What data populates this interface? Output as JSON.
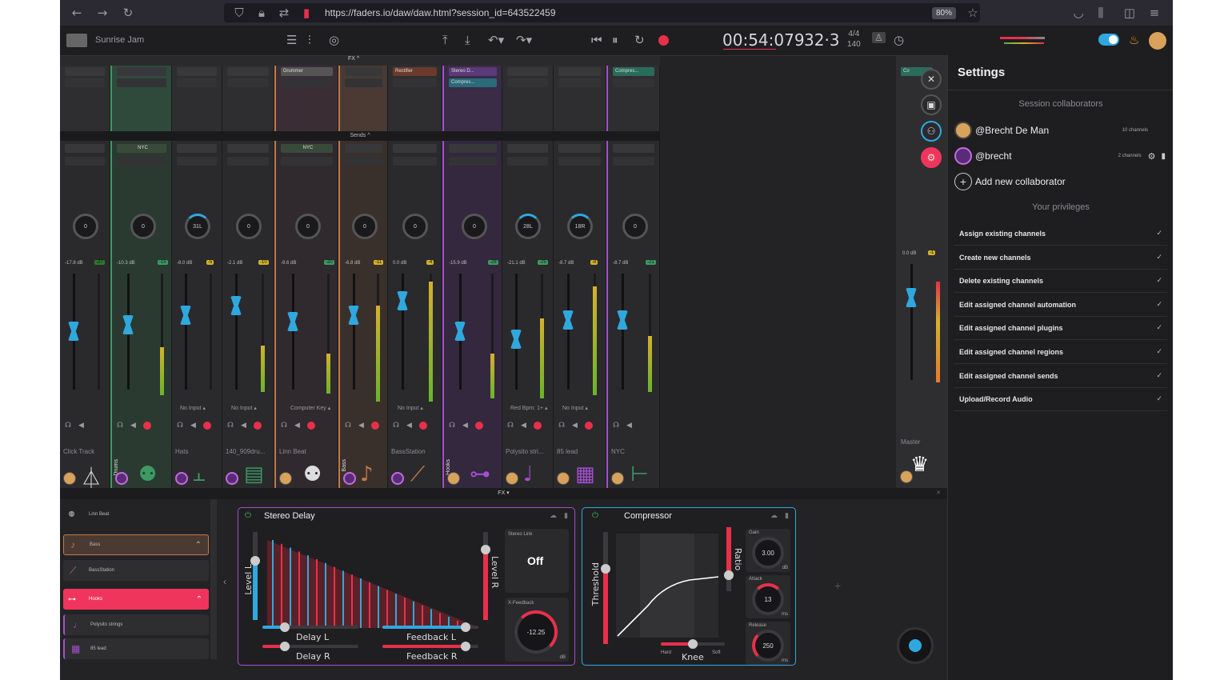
{
  "browser": {
    "url": "https://faders.io/daw/daw.html?session_id=643522459",
    "zoom": "80%"
  },
  "toolbar": {
    "session_name": "Sunrise Jam",
    "time": "00:54:079",
    "position": "32·3",
    "time_signature": "4/4",
    "tempo": "140"
  },
  "mixer": {
    "fx_label": "FX ^",
    "sends_label": "Sends ^",
    "fx_label_bottom": "FX ▾",
    "channels": [
      {
        "name": "Click Track",
        "db": "-17.8 dB",
        "peak": "-27",
        "knob": "0",
        "input": "",
        "icon": "metronome-icon"
      },
      {
        "name": "",
        "group": "Drums",
        "db": "-10.3 dB",
        "peak": "-15",
        "knob": "0",
        "input": "",
        "send": "NYC",
        "icon": "drums-icon"
      },
      {
        "name": "Hats",
        "db": "-8.0 dB",
        "peak": "-5",
        "knob": "31L",
        "input": "No Input",
        "icon": "hihat-icon"
      },
      {
        "name": "140_909dru...",
        "db": "-2.1 dB",
        "peak": "-10",
        "knob": "0",
        "input": "No Input",
        "icon": "drum-machine-icon"
      },
      {
        "name": "Linn Beat",
        "db": "-9.6 dB",
        "peak": "-20",
        "knob": "0",
        "input": "Computer Key",
        "send": "NYC",
        "plugin": "Drummer",
        "icon": "drums-icon"
      },
      {
        "name": "",
        "group": "Bass",
        "db": "-6.8 dB",
        "peak": "-11",
        "knob": "0",
        "input": "",
        "icon": "bass-guitar-icon"
      },
      {
        "name": "BassStation",
        "db": "0.0 dB",
        "peak": "-4",
        "knob": "0",
        "input": "No Input",
        "plugin": "Rectifier",
        "icon": "synth-icon"
      },
      {
        "name": "",
        "group": "Hooks",
        "db": "-15.9 dB",
        "peak": "-28",
        "knob": "0",
        "input": "",
        "plugin": "Stereo D...",
        "plugin2": "Compres...",
        "icon": "trumpet-icon"
      },
      {
        "name": "Polysito stri...",
        "db": "-21.1 dB",
        "peak": "-25",
        "knob": "28L",
        "input": "Red Bpm: 1+",
        "icon": "violin-icon"
      },
      {
        "name": "85 lead",
        "db": "-8.7 dB",
        "peak": "-8",
        "knob": "18R",
        "input": "No Input",
        "icon": "keyboard-icon"
      },
      {
        "name": "NYC",
        "db": "-8.7 dB",
        "peak": "-21",
        "knob": "0",
        "input": "",
        "plugin": "Compres...",
        "icon": "send-bus-icon"
      }
    ],
    "master": {
      "name": "Master",
      "db": "0.0 dB",
      "peak": "-1",
      "plugin": "Co"
    }
  },
  "settings": {
    "title": "Settings",
    "collaborators_heading": "Session collaborators",
    "collaborators": [
      {
        "name": "@Brecht De Man",
        "channels": "10 channels"
      },
      {
        "name": "@brecht",
        "channels": "2 channels"
      }
    ],
    "add_collaborator": "Add new collaborator",
    "privileges_heading": "Your privileges",
    "privileges": [
      "Assign existing channels",
      "Create new channels",
      "Delete existing channels",
      "Edit assigned channel automation",
      "Edit assigned channel plugins",
      "Edit assigned channel regions",
      "Edit assigned channel sends",
      "Upload/Record Audio"
    ]
  },
  "tracklist": {
    "items": [
      "Linn Beat",
      "Bass",
      "BassStation",
      "Hooks",
      "Polysito strings",
      "85 lead"
    ]
  },
  "stereo_delay": {
    "title": "Stereo Delay",
    "level_l": "Level L",
    "level_r": "Level R",
    "delay_l": "Delay L",
    "delay_r": "Delay R",
    "feedback_l": "Feedback L",
    "feedback_r": "Feedback R",
    "stereo_link_label": "Stereo Link",
    "stereo_link_value": "Off",
    "xfeedback_label": "X-Feedback",
    "xfeedback_value": "-12.25",
    "xfeedback_unit": "dB"
  },
  "compressor": {
    "title": "Compressor",
    "threshold": "Threshold",
    "ratio": "Ratio",
    "knee": "Knee",
    "knee_hard": "Hard",
    "knee_soft": "Soft",
    "gain_label": "Gain",
    "gain_value": "3.00",
    "gain_unit": "dB",
    "attack_label": "Attack",
    "attack_value": "13",
    "attack_unit": "ms",
    "release_label": "Release",
    "release_value": "250",
    "release_unit": "ms"
  },
  "colors": {
    "accent_blue": "#2fa8df",
    "record_red": "#e8304a",
    "drums_green": "#3b9b63",
    "bass_orange": "#c07a4a",
    "hooks_purple": "#a44fd0",
    "hooks_pink": "#f0355c"
  }
}
